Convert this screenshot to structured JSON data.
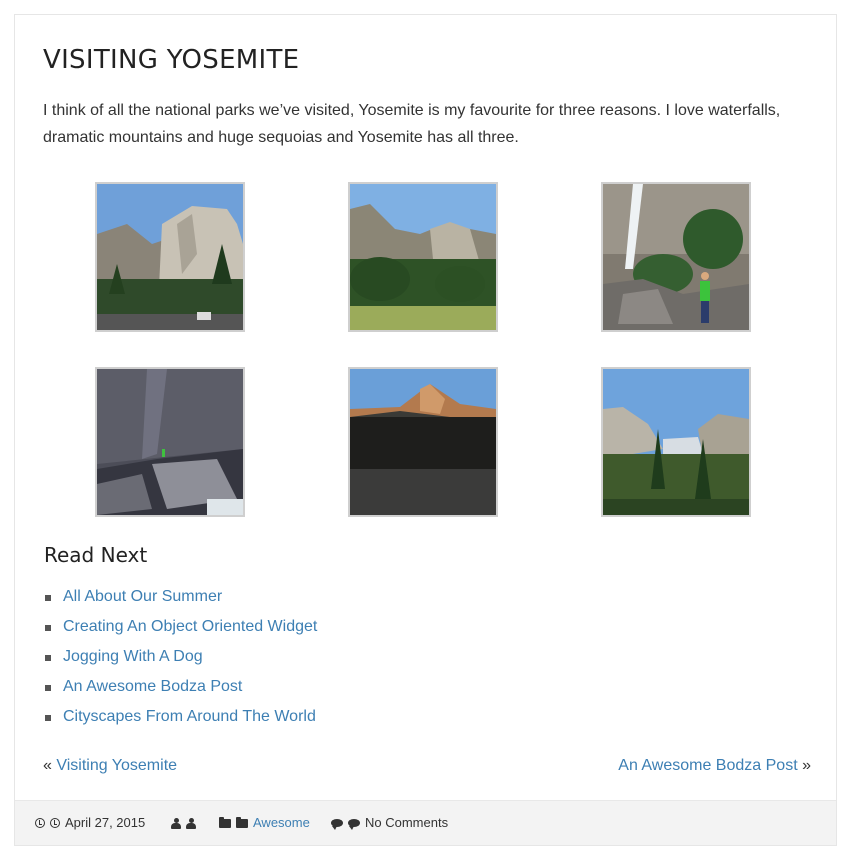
{
  "post": {
    "title": "VISITING YOSEMITE",
    "intro": "I think of all the national parks we’ve visited, Yosemite is my favourite for three reasons. I love waterfalls, dramatic mountains and huge sequoias and Yosemite has all three."
  },
  "gallery": {
    "items": [
      {
        "subject": "granite cliff with pine trees"
      },
      {
        "subject": "valley meadow with cliffs"
      },
      {
        "subject": "waterfall with man in green shirt"
      },
      {
        "subject": "granite rocks and river with person"
      },
      {
        "subject": "mountain peak at sunset"
      },
      {
        "subject": "tunnel view of valley"
      }
    ]
  },
  "read_next": {
    "heading": "Read Next",
    "items": [
      "All About Our Summer",
      "Creating An Object Oriented Widget",
      "Jogging With A Dog",
      "An Awesome Bodza Post",
      "Cityscapes From Around The World"
    ]
  },
  "post_nav": {
    "prev_marker": "«",
    "prev_label": "Visiting Yosemite",
    "next_label": "An Awesome Bodza Post",
    "next_marker": "»"
  },
  "meta": {
    "date": "April 27, 2015",
    "category": "Awesome",
    "comments": "No Comments"
  },
  "colors": {
    "link": "#3d7fb3",
    "footer_bg": "#f3f3f3"
  },
  "icons": [
    "clock-icon",
    "user-icon",
    "folder-icon",
    "comment-icon"
  ]
}
